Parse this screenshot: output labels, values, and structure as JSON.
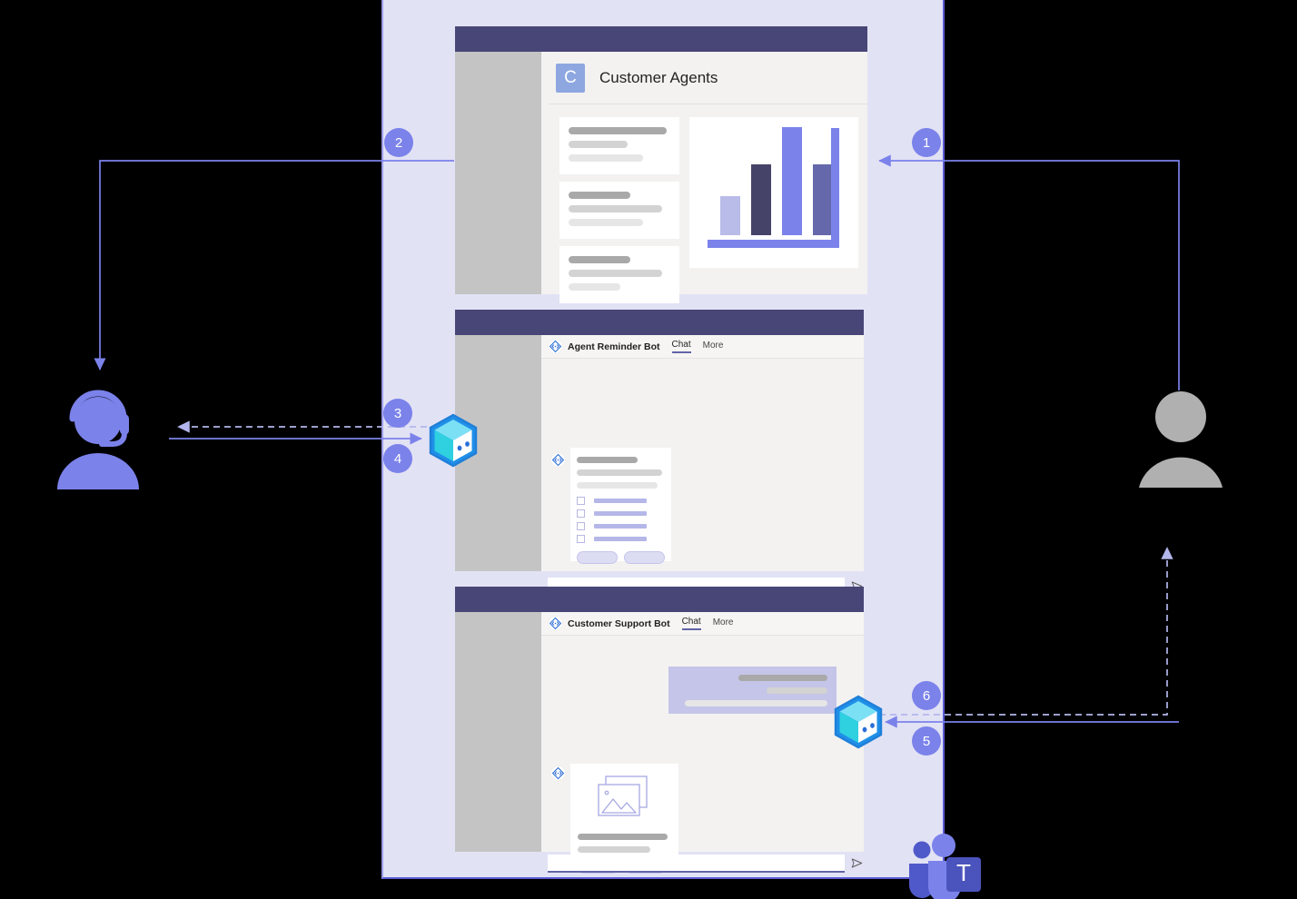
{
  "diagram": {
    "title": "Microsoft Teams customer support bot flow",
    "backdrop_color": "#e2e2f5",
    "accent_color": "#7b82ea",
    "badge_color": "#7b82ea"
  },
  "actors": {
    "agent": {
      "name": "Customer agent",
      "icon": "agent-headset-icon",
      "color": "#7b82ea"
    },
    "customer": {
      "name": "Customer",
      "icon": "person-icon",
      "color": "#b0b0b0"
    }
  },
  "windows": {
    "customer_agents": {
      "app_title": "Customer Agents",
      "avatar_letter": "C",
      "avatar_color": "#8ea7e0",
      "cards": [
        {
          "lines": [
            "dark",
            "mid",
            "light"
          ]
        },
        {
          "lines": [
            "dark",
            "mid",
            "light"
          ]
        },
        {
          "lines": [
            "dark",
            "mid",
            "light"
          ]
        }
      ],
      "chart": {
        "bars": [
          {
            "value": 30,
            "color": "#b9bce8"
          },
          {
            "value": 55,
            "color": "#454368"
          },
          {
            "value": 100,
            "color": "#7b82ea"
          },
          {
            "value": 55,
            "color": "#6568ab"
          }
        ],
        "axis_color": "#7b82ea"
      }
    },
    "agent_reminder": {
      "bot_name": "Agent Reminder Bot",
      "tabs": [
        {
          "label": "Chat",
          "active": true
        },
        {
          "label": "More",
          "active": false
        }
      ],
      "card": {
        "text_lines": [
          "dark",
          "mid",
          "light"
        ],
        "checklist_items": 4,
        "buttons": 2
      },
      "compose_placeholder": ""
    },
    "customer_support": {
      "bot_name": "Customer Support Bot",
      "tabs": [
        {
          "label": "Chat",
          "active": true
        },
        {
          "label": "More",
          "active": false
        }
      ],
      "user_message_lines": [
        "dark",
        "mid",
        "light"
      ],
      "card": {
        "has_image": true,
        "text_lines": [
          "dark",
          "mid"
        ],
        "buttons": 2
      },
      "compose_placeholder": ""
    }
  },
  "bots": [
    {
      "id": "bot-agent-side",
      "icon": "bot-cube-icon"
    },
    {
      "id": "bot-customer-side",
      "icon": "bot-cube-icon"
    }
  ],
  "steps": [
    {
      "number": "1",
      "style": "solid",
      "from": "customer",
      "to": "customer-agents-window"
    },
    {
      "number": "2",
      "style": "solid",
      "from": "customer-agents-window",
      "to": "agent"
    },
    {
      "number": "3",
      "style": "dashed",
      "from": "bot-agent-side",
      "to": "agent"
    },
    {
      "number": "4",
      "style": "solid",
      "from": "agent",
      "to": "bot-agent-side"
    },
    {
      "number": "5",
      "style": "solid",
      "from": "customer",
      "to": "bot-customer-side"
    },
    {
      "number": "6",
      "style": "dashed",
      "from": "bot-customer-side",
      "to": "customer"
    }
  ],
  "branding": {
    "product": "Microsoft Teams",
    "logo_letter": "T",
    "logo_color": "#5059c9"
  }
}
